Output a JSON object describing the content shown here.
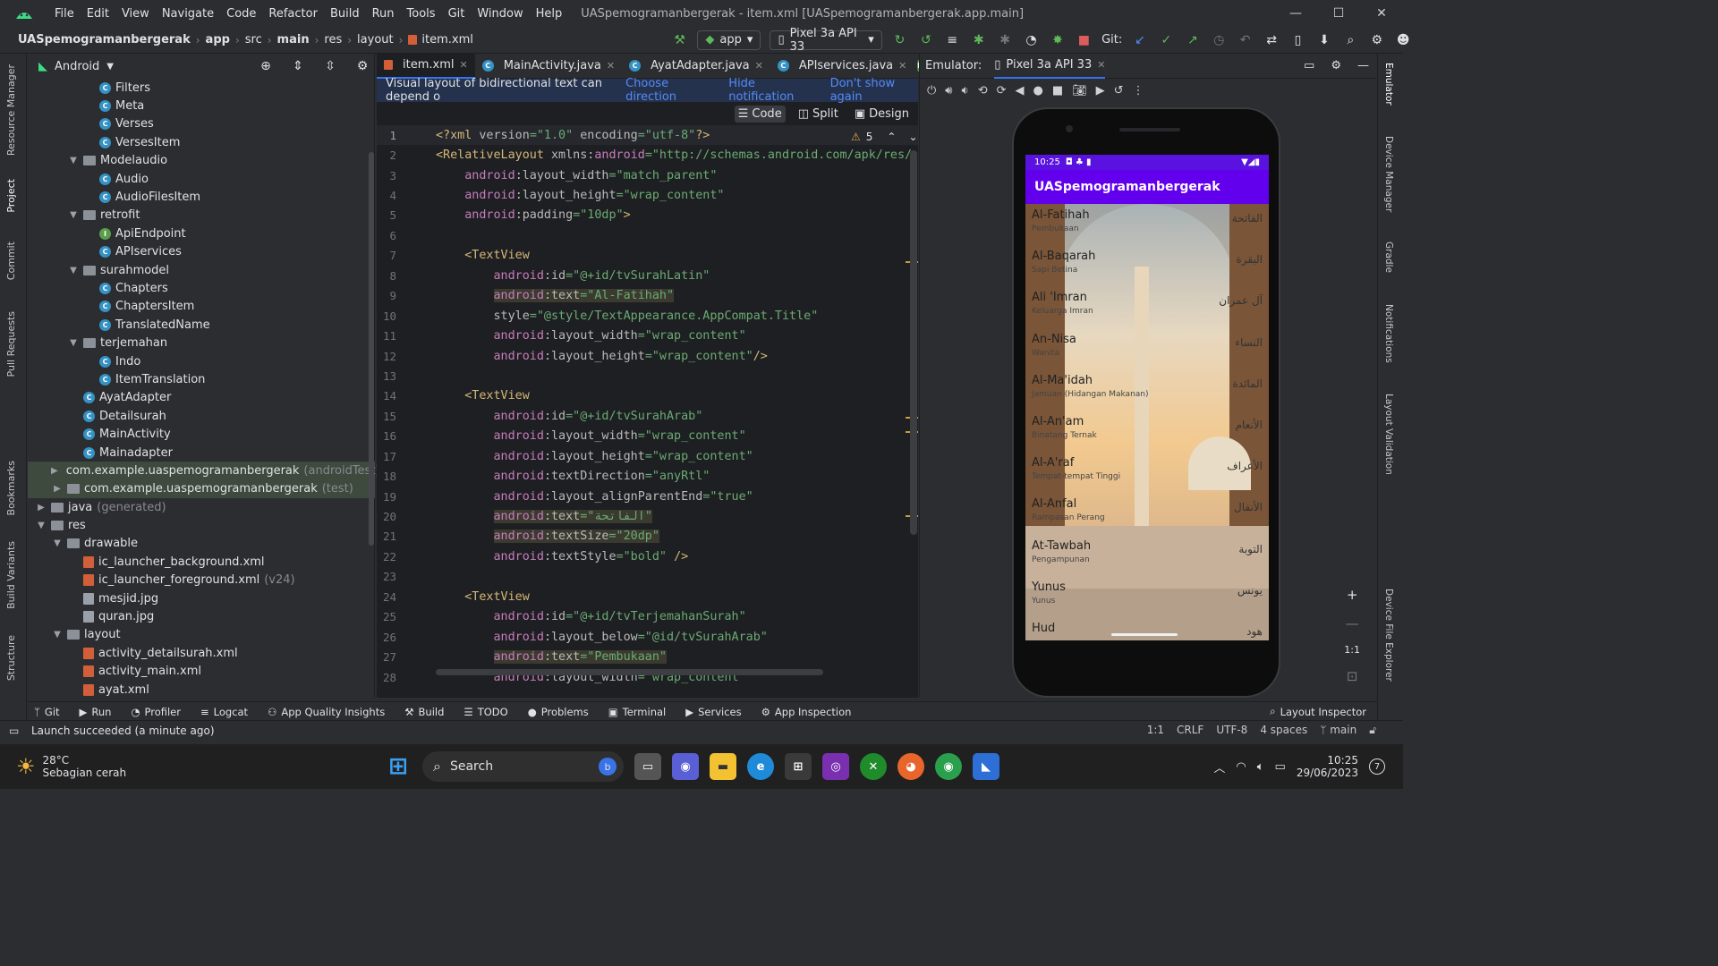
{
  "window": {
    "title": "UASpemogramanbergerak - item.xml [UASpemogramanbergerak.app.main]",
    "menu": [
      "File",
      "Edit",
      "View",
      "Navigate",
      "Code",
      "Refactor",
      "Build",
      "Run",
      "Tools",
      "Git",
      "Window",
      "Help"
    ]
  },
  "nav": {
    "crumbs": [
      "UASpemogramanbergerak",
      "app",
      "src",
      "main",
      "res",
      "layout",
      "item.xml"
    ],
    "run_config": "app",
    "device": "Pixel 3a API 33",
    "git_label": "Git:"
  },
  "project": {
    "view": "Android",
    "rows": [
      {
        "i": 5,
        "t": "c",
        "label": "Filters"
      },
      {
        "i": 5,
        "t": "c",
        "label": "Meta"
      },
      {
        "i": 5,
        "t": "c",
        "label": "Verses"
      },
      {
        "i": 5,
        "t": "c",
        "label": "VersesItem"
      },
      {
        "i": 4,
        "t": "f",
        "label": "Modelaudio",
        "arr": "v"
      },
      {
        "i": 5,
        "t": "c",
        "label": "Audio"
      },
      {
        "i": 5,
        "t": "c",
        "label": "AudioFilesItem"
      },
      {
        "i": 4,
        "t": "f",
        "label": "retrofit",
        "arr": "v"
      },
      {
        "i": 5,
        "t": "i",
        "label": "ApiEndpoint"
      },
      {
        "i": 5,
        "t": "c",
        "label": "APIservices"
      },
      {
        "i": 4,
        "t": "f",
        "label": "surahmodel",
        "arr": "v"
      },
      {
        "i": 5,
        "t": "c",
        "label": "Chapters"
      },
      {
        "i": 5,
        "t": "c",
        "label": "ChaptersItem"
      },
      {
        "i": 5,
        "t": "c",
        "label": "TranslatedName"
      },
      {
        "i": 4,
        "t": "f",
        "label": "terjemahan",
        "arr": "v"
      },
      {
        "i": 5,
        "t": "c",
        "label": "Indo"
      },
      {
        "i": 5,
        "t": "c",
        "label": "ItemTranslation"
      },
      {
        "i": 4,
        "t": "c",
        "label": "AyatAdapter"
      },
      {
        "i": 4,
        "t": "c",
        "label": "Detailsurah"
      },
      {
        "i": 4,
        "t": "c",
        "label": "MainActivity"
      },
      {
        "i": 4,
        "t": "c",
        "label": "Mainadapter"
      },
      {
        "i": 3,
        "t": "f",
        "label": "com.example.uaspemogramanbergerak",
        "suffix": "(androidTest)",
        "arr": ">",
        "sel": true
      },
      {
        "i": 3,
        "t": "f",
        "label": "com.example.uaspemogramanbergerak",
        "suffix": "(test)",
        "arr": ">",
        "sel": true
      },
      {
        "i": 2,
        "t": "f",
        "label": "java",
        "suffix": "(generated)",
        "arr": ">"
      },
      {
        "i": 2,
        "t": "f",
        "label": "res",
        "arr": "v"
      },
      {
        "i": 3,
        "t": "f",
        "label": "drawable",
        "arr": "v"
      },
      {
        "i": 4,
        "t": "x",
        "label": "ic_launcher_background.xml"
      },
      {
        "i": 4,
        "t": "x",
        "label": "ic_launcher_foreground.xml",
        "suffix": "(v24)"
      },
      {
        "i": 4,
        "t": "j",
        "label": "mesjid.jpg"
      },
      {
        "i": 4,
        "t": "j",
        "label": "quran.jpg"
      },
      {
        "i": 3,
        "t": "f",
        "label": "layout",
        "arr": "v"
      },
      {
        "i": 4,
        "t": "x",
        "label": "activity_detailsurah.xml"
      },
      {
        "i": 4,
        "t": "x",
        "label": "activity_main.xml"
      },
      {
        "i": 4,
        "t": "x",
        "label": "ayat.xml"
      }
    ]
  },
  "editor": {
    "tabs": [
      "item.xml",
      "MainActivity.java",
      "AyatAdapter.java",
      "APIservices.java"
    ],
    "notification": {
      "text": "Visual layout of bidirectional text can depend o",
      "choose": "Choose direction",
      "hide": "Hide notification",
      "dont": "Don't show again"
    },
    "modes": [
      "Code",
      "Split",
      "Design"
    ],
    "warnings": "5",
    "lines": [
      {
        "n": "1",
        "h": "<span class='pi'>&lt;?xml </span><span class='attr'>version</span><span class='val'>=\"1.0\" </span><span class='attr'>encoding</span><span class='val'>=\"utf-8\"</span><span class='pi'>?&gt;</span>"
      },
      {
        "n": "2",
        "h": "<span class='tag'>&lt;RelativeLayout </span><span class='attr'>xmlns:</span><span class='ns'>android</span><span class='val'>=\"http://schemas.android.com/apk/res/</span>"
      },
      {
        "n": "3",
        "h": "    <span class='ns'>android</span><span class='attr'>:layout_width</span><span class='val'>=\"match_parent\"</span>"
      },
      {
        "n": "4",
        "h": "    <span class='ns'>android</span><span class='attr'>:layout_height</span><span class='val'>=\"wrap_content\"</span>"
      },
      {
        "n": "5",
        "h": "    <span class='ns'>android</span><span class='attr'>:padding</span><span class='val'>=\"10dp\"</span><span class='tag'>&gt;</span>"
      },
      {
        "n": "6",
        "h": ""
      },
      {
        "n": "7",
        "h": "    <span class='tag'>&lt;TextView</span>"
      },
      {
        "n": "8",
        "h": "        <span class='ns'>android</span><span class='attr'>:id</span><span class='val'>=\"@+id/tvSurahLatin\"</span>"
      },
      {
        "n": "9",
        "h": "        <span class='hl'><span class='ns'>android</span><span class='attr'>:text</span><span class='val'>=\"Al-Fatihah\"</span></span>"
      },
      {
        "n": "10",
        "h": "        <span class='attr'>style</span><span class='val'>=\"@style/TextAppearance.AppCompat.Title\"</span>"
      },
      {
        "n": "11",
        "h": "        <span class='ns'>android</span><span class='attr'>:layout_width</span><span class='val'>=\"wrap_content\"</span>"
      },
      {
        "n": "12",
        "h": "        <span class='ns'>android</span><span class='attr'>:layout_height</span><span class='val'>=\"wrap_content\"</span><span class='tag'>/&gt;</span>"
      },
      {
        "n": "13",
        "h": ""
      },
      {
        "n": "14",
        "h": "    <span class='tag'>&lt;TextView</span>"
      },
      {
        "n": "15",
        "h": "        <span class='ns'>android</span><span class='attr'>:id</span><span class='val'>=\"@+id/tvSurahArab\"</span>"
      },
      {
        "n": "16",
        "h": "        <span class='ns'>android</span><span class='attr'>:layout_width</span><span class='val'>=\"wrap_content\"</span>"
      },
      {
        "n": "17",
        "h": "        <span class='ns'>android</span><span class='attr'>:layout_height</span><span class='val'>=\"wrap_content\"</span>"
      },
      {
        "n": "18",
        "h": "        <span class='ns'>android</span><span class='attr'>:textDirection</span><span class='val'>=\"anyRtl\"</span>"
      },
      {
        "n": "19",
        "h": "        <span class='ns'>android</span><span class='attr'>:layout_alignParentEnd</span><span class='val'>=\"true\"</span>"
      },
      {
        "n": "20",
        "h": "        <span class='hl'><span class='ns'>android</span><span class='attr'>:text</span><span class='val'>=\"الفاتحة\"</span></span>"
      },
      {
        "n": "21",
        "h": "        <span class='hl'><span class='ns'>android</span><span class='attr'>:textSize</span><span class='val'>=\"20dp\"</span></span>"
      },
      {
        "n": "22",
        "h": "        <span class='ns'>android</span><span class='attr'>:textStyle</span><span class='val'>=\"bold\" </span><span class='tag'>/&gt;</span>"
      },
      {
        "n": "23",
        "h": ""
      },
      {
        "n": "24",
        "h": "    <span class='tag'>&lt;TextView</span>"
      },
      {
        "n": "25",
        "h": "        <span class='ns'>android</span><span class='attr'>:id</span><span class='val'>=\"@+id/tvTerjemahanSurah\"</span>"
      },
      {
        "n": "26",
        "h": "        <span class='ns'>android</span><span class='attr'>:layout_below</span><span class='val'>=\"@id/tvSurahArab\"</span>"
      },
      {
        "n": "27",
        "h": "        <span class='hl'><span class='ns'>android</span><span class='attr'>:text</span><span class='val'>=\"Pembukaan\"</span></span>"
      },
      {
        "n": "28",
        "h": "        <span class='ns'>android</span><span class='attr'>:layout_width</span><span class='val'>=\"wrap_content\"</span>"
      }
    ]
  },
  "emulator": {
    "label": "Emulator:",
    "tab": "Pixel 3a API 33",
    "time": "10:25",
    "app_title": "UASpemogramanbergerak",
    "surahs": [
      {
        "latin": "Al-Fatihah",
        "arab": "الفاتحة",
        "tr": "Pembukaan"
      },
      {
        "latin": "Al-Baqarah",
        "arab": "البقرة",
        "tr": "Sapi Betina"
      },
      {
        "latin": "Ali 'Imran",
        "arab": "آل عمران",
        "tr": "Keluarga Imran"
      },
      {
        "latin": "An-Nisa",
        "arab": "النساء",
        "tr": "Wanita"
      },
      {
        "latin": "Al-Ma'idah",
        "arab": "المائدة",
        "tr": "Jamuan (Hidangan Makanan)"
      },
      {
        "latin": "Al-An'am",
        "arab": "الأنعام",
        "tr": "Binatang Ternak"
      },
      {
        "latin": "Al-A'raf",
        "arab": "الأعراف",
        "tr": "Tempat-tempat Tinggi"
      },
      {
        "latin": "Al-Anfal",
        "arab": "الأنفال",
        "tr": "Rampasan Perang"
      },
      {
        "latin": "At-Tawbah",
        "arab": "التوبة",
        "tr": "Pengampunan"
      },
      {
        "latin": "Yunus",
        "arab": "يونس",
        "tr": "Yunus"
      },
      {
        "latin": "Hud",
        "arab": "هود",
        "tr": ""
      }
    ],
    "zoom_label": "1:1"
  },
  "left_tabs": [
    "Resource Manager",
    "Project",
    "Commit",
    "Pull Requests",
    "Bookmarks",
    "Build Variants",
    "Structure"
  ],
  "right_tabs": [
    "Emulator",
    "Device Manager",
    "Gradle",
    "Notifications",
    "Layout Validation",
    "Device File Explorer"
  ],
  "bottom_tools": [
    "Git",
    "Run",
    "Profiler",
    "Logcat",
    "App Quality Insights",
    "Build",
    "TODO",
    "Problems",
    "Terminal",
    "Services",
    "App Inspection"
  ],
  "layout_inspector": "Layout Inspector",
  "status": {
    "message": "Launch succeeded (a minute ago)",
    "pos": "1:1",
    "eol": "CRLF",
    "enc": "UTF-8",
    "indent": "4 spaces",
    "branch": "main"
  },
  "taskbar": {
    "temp": "28°C",
    "weather": "Sebagian cerah",
    "search": "Search",
    "time": "10:25",
    "date": "29/06/2023"
  },
  "colors": {
    "accent": "#3574f0",
    "app_bar": "#6200ee",
    "status_bar": "#5a12e0"
  }
}
